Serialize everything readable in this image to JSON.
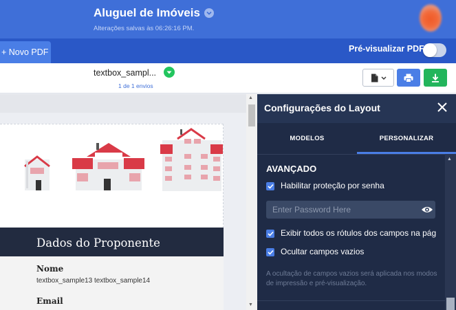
{
  "header": {
    "title": "Aluguel de Imóveis",
    "saved_status": "Alterações salvas às 06:26:16 PM."
  },
  "toolbar": {
    "new_pdf_label": "+ Novo PDF",
    "preview_label": "Pré-visualizar PDF",
    "preview_enabled": false
  },
  "document": {
    "name": "textbox_sampl...",
    "count": "1 de 1 envios"
  },
  "pdf_page": {
    "section_title": "Dados do Proponente",
    "fields": [
      {
        "label": "Nome",
        "value": "textbox_sample13 textbox_sample14"
      },
      {
        "label": "Email",
        "value": ""
      }
    ]
  },
  "panel": {
    "title": "Configurações do Layout",
    "tabs": [
      {
        "label": "MODELOS",
        "active": false
      },
      {
        "label": "PERSONALIZAR",
        "active": true
      }
    ],
    "section_title": "AVANÇADO",
    "options": [
      {
        "label": "Habilitar proteção por senha",
        "checked": true
      },
      {
        "label": "Exibir todos os rótulos dos campos na pág",
        "checked": true
      },
      {
        "label": "Ocultar campos vazios",
        "checked": true
      }
    ],
    "password_placeholder": "Enter Password Here",
    "hint": "A ocultação de campos vazios será aplicada nos modos de impressão e pré-visualização."
  },
  "colors": {
    "topbar": "#3f6fd8",
    "panel": "#1f2b46",
    "accent": "#4a7ee6",
    "success": "#23b55c",
    "house_roof": "#d93a47"
  },
  "icons": [
    "chevron-down-icon",
    "check-circle-icon",
    "document-icon",
    "printer-icon",
    "download-icon",
    "close-icon",
    "eye-icon",
    "checkbox-checked-icon"
  ]
}
